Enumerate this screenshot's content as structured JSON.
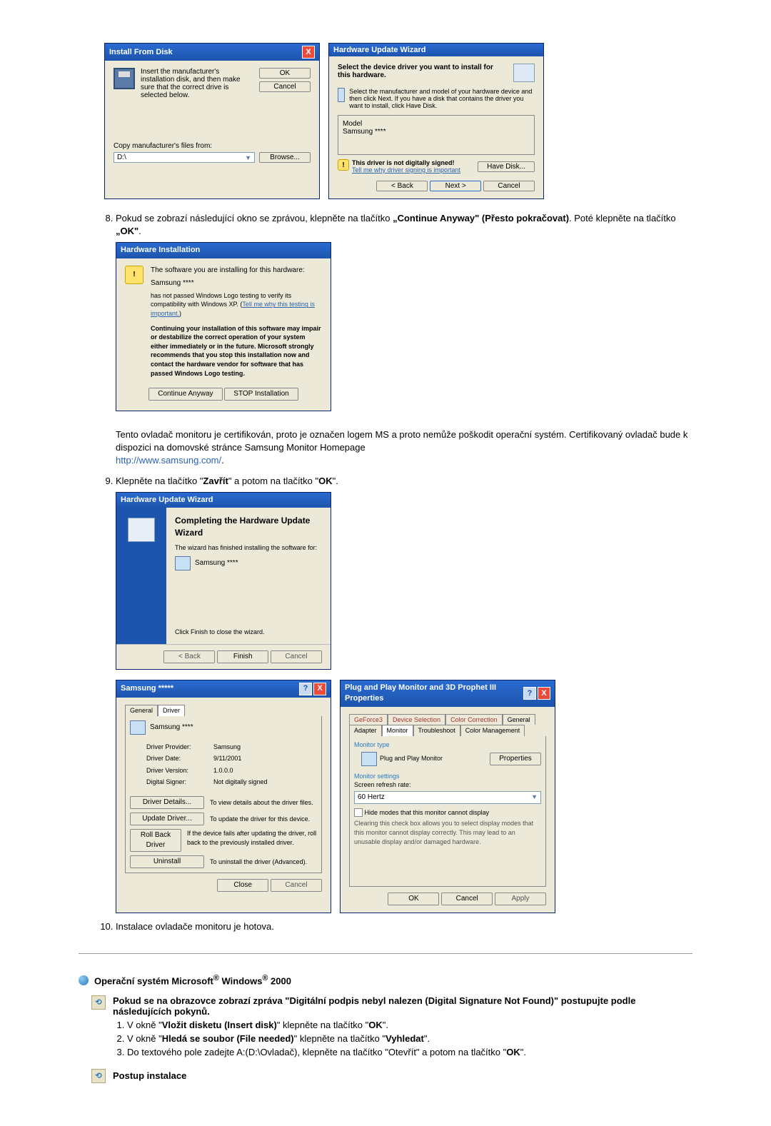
{
  "dlgInstallFromDisk": {
    "title": "Install From Disk",
    "instr": "Insert the manufacturer's installation disk, and then make sure that the correct drive is selected below.",
    "ok": "OK",
    "cancel": "Cancel",
    "copyLabel": "Copy manufacturer's files from:",
    "path": "D:\\",
    "browse": "Browse..."
  },
  "dlgHuw1": {
    "title": "Hardware Update Wizard",
    "line1": "Select the device driver you want to install for this hardware.",
    "line2": "Select the manufacturer and model of your hardware device and then click Next. If you have a disk that contains the driver you want to install, click Have Disk.",
    "modelLabel": "Model",
    "model": "Samsung ****",
    "warn": "This driver is not digitally signed!",
    "tellme": "Tell me why driver signing is important",
    "haveDisk": "Have Disk...",
    "back": "< Back",
    "next": "Next >",
    "cancel": "Cancel"
  },
  "step8": {
    "text_a": "Pokud se zobrazí následující okno se zprávou, klepněte na tlačítko ",
    "b1": "„Continue Anyway\" (Přesto pokračovat)",
    "text_b": ". Poté klepněte na tlačítko ",
    "b2": "„OK\"",
    "text_c": "."
  },
  "dlgHwInstall": {
    "title": "Hardware Installation",
    "l1": "The software you are installing for this hardware:",
    "l2": "Samsung ****",
    "l3": "has not passed Windows Logo testing to verify its compatibility with Windows XP. (",
    "l3link": "Tell me why this testing is important.",
    "l3end": ")",
    "l4": "Continuing your installation of this software may impair or destabilize the correct operation of your system either immediately or in the future. Microsoft strongly recommends that you stop this installation now and contact the hardware vendor for software that has passed Windows Logo testing.",
    "btnCont": "Continue Anyway",
    "btnStop": "STOP Installation"
  },
  "para_cert": "Tento ovladač monitoru je certifikován, proto je označen logem MS a proto nemůže poškodit operační systém. Certifikovaný ovladač bude k dispozici na domovské stránce Samsung Monitor Homepage",
  "samsung_url": "http://www.samsung.com/",
  "step9": {
    "text_a": "Klepněte na tlačítko \"",
    "b1": "Zavřít",
    "text_b": "\" a potom na tlačítko \"",
    "b2": "OK",
    "text_c": "\"."
  },
  "dlgHuwDone": {
    "title": "Hardware Update Wizard",
    "h": "Completing the Hardware Update Wizard",
    "sub": "The wizard has finished installing the software for:",
    "dev": "Samsung ****",
    "foot": "Click Finish to close the wizard.",
    "back": "< Back",
    "finish": "Finish",
    "cancel": "Cancel"
  },
  "dlgDriver": {
    "title": "Samsung *****",
    "tab1": "General",
    "tab2": "Driver",
    "dev": "Samsung ****",
    "rows": {
      "prov_l": "Driver Provider:",
      "prov_v": "Samsung",
      "date_l": "Driver Date:",
      "date_v": "9/11/2001",
      "ver_l": "Driver Version:",
      "ver_v": "1.0.0.0",
      "sig_l": "Digital Signer:",
      "sig_v": "Not digitally signed"
    },
    "btnDetails": "Driver Details...",
    "btnDetailsTxt": "To view details about the driver files.",
    "btnUpdate": "Update Driver...",
    "btnUpdateTxt": "To update the driver for this device.",
    "btnRoll": "Roll Back Driver",
    "btnRollTxt": "If the device fails after updating the driver, roll back to the previously installed driver.",
    "btnUninst": "Uninstall",
    "btnUninstTxt": "To uninstall the driver (Advanced).",
    "close": "Close",
    "cancel": "Cancel"
  },
  "dlgPnp": {
    "title": "Plug and Play Monitor and 3D Prophet III Properties",
    "tabs": {
      "t1": "GeForce3",
      "t2": "Device Selection",
      "t3": "Color Correction",
      "t4": "General",
      "t5": "Adapter",
      "t6": "Monitor",
      "t7": "Troubleshoot",
      "t8": "Color Management"
    },
    "mtype": "Monitor type",
    "mname": "Plug and Play Monitor",
    "props": "Properties",
    "msettings": "Monitor settings",
    "refresh": "Screen refresh rate:",
    "hz": "60 Hertz",
    "chk": "Hide modes that this monitor cannot display",
    "note": "Clearing this check box allows you to select display modes that this monitor cannot display correctly. This may lead to an unusable display and/or damaged hardware.",
    "ok": "OK",
    "cancel": "Cancel",
    "apply": "Apply"
  },
  "step10": "Instalace ovladače monitoru je hotova.",
  "win2000": {
    "heading_a": "Operační systém Microsoft",
    "heading_b": " Windows",
    "heading_c": " 2000",
    "intro": "Pokud se na obrazovce zobrazí zpráva \"Digitální podpis nebyl nalezen (Digital Signature Not Found)\" postupujte podle následujících pokynů.",
    "s1_a": "V okně \"",
    "s1_b": "Vložit disketu (Insert disk)",
    "s1_c": "\" klepněte na tlačítko \"",
    "s1_d": "OK",
    "s1_e": "\".",
    "s2_a": "V okně \"",
    "s2_b": "Hledá se soubor (File needed)",
    "s2_c": "\" klepněte na tlačítko \"",
    "s2_d": "Vyhledat",
    "s2_e": "\".",
    "s3_a": "Do textového pole zadejte A:(D:\\Ovladač), klepněte na tlačítko \"Otevřít\" a potom na tlačítko \"",
    "s3_b": "OK",
    "s3_c": "\".",
    "postup": "Postup instalace"
  }
}
